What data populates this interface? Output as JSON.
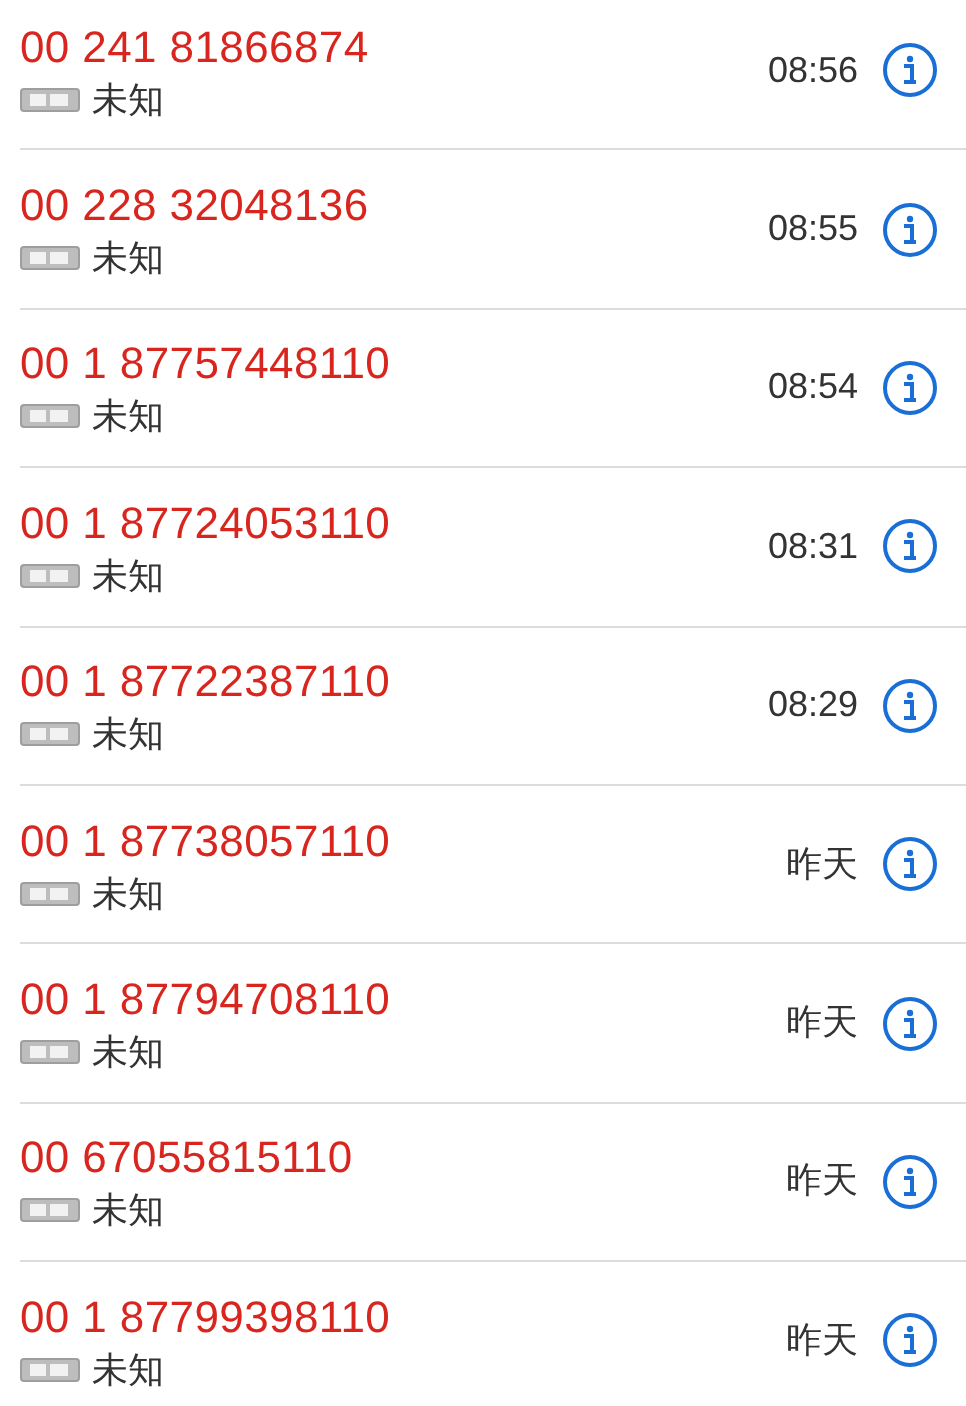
{
  "calls": [
    {
      "number": "00 241 81866874",
      "label": "未知",
      "time": "08:56"
    },
    {
      "number": "00 228 32048136",
      "label": "未知",
      "time": "08:55"
    },
    {
      "number": "00 1 87757448110",
      "label": "未知",
      "time": "08:54"
    },
    {
      "number": "00 1 87724053110",
      "label": "未知",
      "time": "08:31"
    },
    {
      "number": "00 1 87722387110",
      "label": "未知",
      "time": "08:29"
    },
    {
      "number": "00 1 87738057110",
      "label": "未知",
      "time": "昨天"
    },
    {
      "number": "00 1 87794708110",
      "label": "未知",
      "time": "昨天"
    },
    {
      "number": "00 67055815110",
      "label": "未知",
      "time": "昨天"
    },
    {
      "number": "00 1 87799398110",
      "label": "未知",
      "time": "昨天"
    }
  ]
}
